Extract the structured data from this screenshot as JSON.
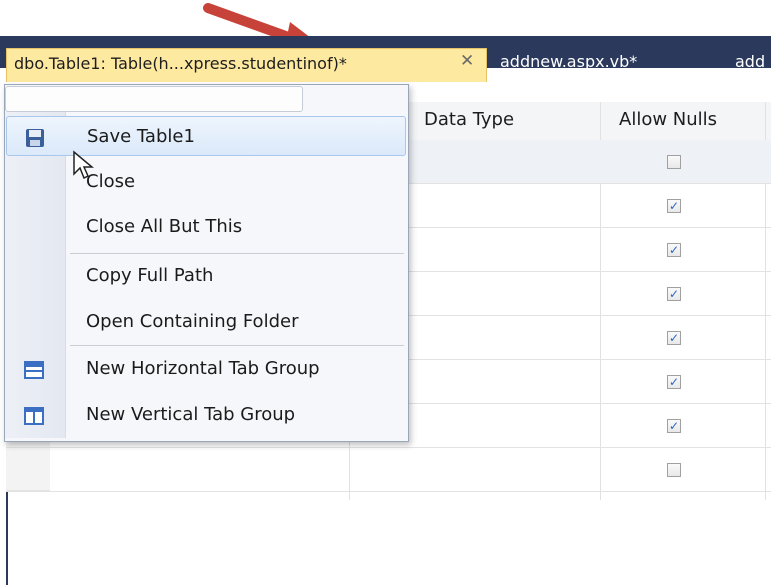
{
  "tabs": {
    "active": "dbo.Table1: Table(h...xpress.studentinof)*",
    "close_glyph": "✕",
    "others": [
      "addnew.aspx.vb*",
      "add"
    ]
  },
  "grid": {
    "columns": [
      "Data Type",
      "Allow Nulls"
    ],
    "rows": [
      {
        "allow_nulls": false
      },
      {
        "allow_nulls": true
      },
      {
        "allow_nulls": true
      },
      {
        "allow_nulls": true
      },
      {
        "allow_nulls": true
      },
      {
        "allow_nulls": true
      },
      {
        "allow_nulls": true
      },
      {
        "allow_nulls": false
      }
    ]
  },
  "context_menu": {
    "items": [
      {
        "label": "Save Table1",
        "icon": "save-icon",
        "hover": true
      },
      {
        "label": "Close"
      },
      {
        "label": "Close All But This"
      },
      {
        "label": "Copy Full Path"
      },
      {
        "label": "Open Containing Folder"
      },
      {
        "label": "New Horizontal Tab Group",
        "icon": "horizontal-tab-group-icon"
      },
      {
        "label": "New Vertical Tab Group",
        "icon": "vertical-tab-group-icon"
      }
    ]
  },
  "colors": {
    "tabstrip": "#2b3a5c",
    "active_tab": "#fde9a0",
    "arrow": "#c7433a",
    "hover": "#dbe9fa"
  }
}
